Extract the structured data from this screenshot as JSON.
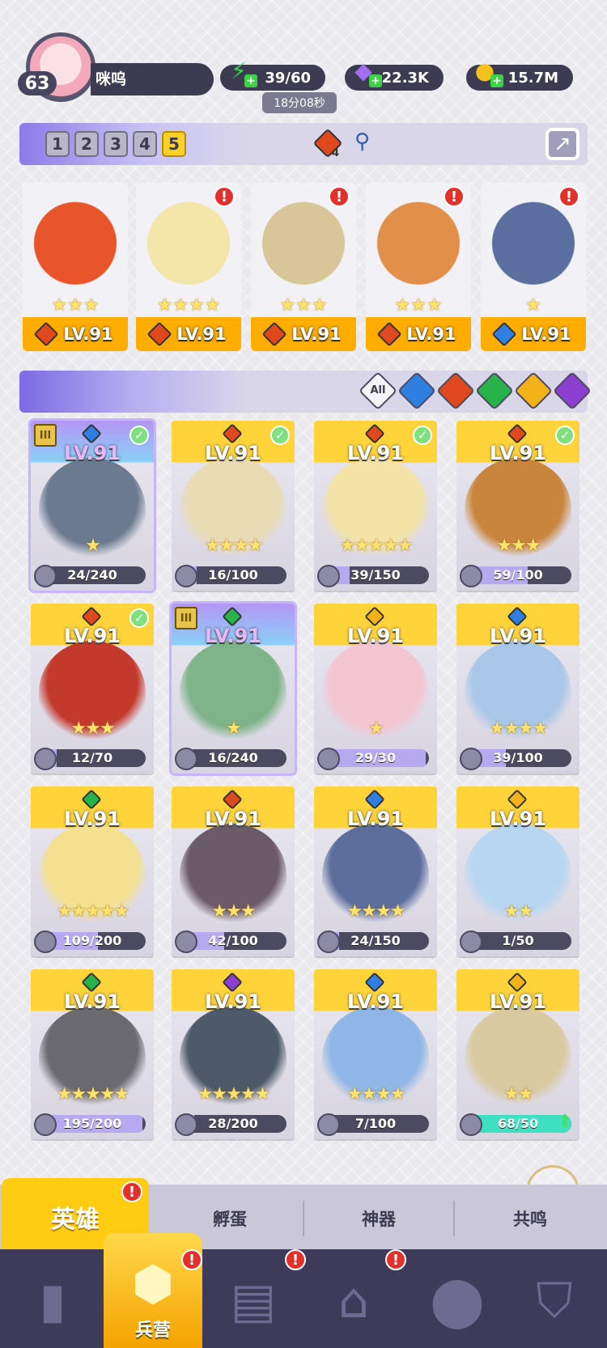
{
  "player": {
    "level": "63",
    "name": "咪呜"
  },
  "resources": {
    "energy": {
      "value": "39/60",
      "icon": "lightning-icon"
    },
    "gems": {
      "value": "22.3K",
      "icon": "diamond-icon"
    },
    "coins": {
      "value": "15.7M",
      "icon": "coin-icon"
    },
    "timer": "18分08秒"
  },
  "teams": {
    "slots": [
      "1",
      "2",
      "3",
      "4",
      "5"
    ],
    "active": "5",
    "fire_count": "4"
  },
  "team_heroes": [
    {
      "level": "LV.91",
      "stars": "★★★",
      "element": "fire",
      "art": "#e8552a"
    },
    {
      "level": "LV.91",
      "stars": "★★★★",
      "element": "fire",
      "art": "#f4e6a8"
    },
    {
      "level": "LV.91",
      "stars": "★★★",
      "element": "fire",
      "art": "#d8c598"
    },
    {
      "level": "LV.91",
      "stars": "★★★",
      "element": "fire",
      "art": "#e28f4a"
    },
    {
      "level": "LV.91",
      "stars": "★",
      "element": "water",
      "art": "#5a6fa0"
    }
  ],
  "filters": [
    "All",
    "water",
    "fire",
    "wind",
    "light",
    "dark"
  ],
  "heroes": [
    {
      "level": "LV.91",
      "stars": "★",
      "progress": "24/240",
      "frac": 0.1,
      "element": "water",
      "check": true,
      "art": "#6b7a8f",
      "purple": true
    },
    {
      "level": "LV.91",
      "stars": "★★★★",
      "progress": "16/100",
      "frac": 0.16,
      "element": "fire",
      "check": true,
      "art": "#e9dbb4"
    },
    {
      "level": "LV.91",
      "stars": "★★★★★",
      "progress": "39/150",
      "frac": 0.26,
      "element": "fire",
      "check": true,
      "art": "#f3e3a6"
    },
    {
      "level": "LV.91",
      "stars": "★★★",
      "progress": "59/100",
      "frac": 0.59,
      "element": "fire",
      "check": true,
      "art": "#c9853c"
    },
    {
      "level": "LV.91",
      "stars": "★★★",
      "progress": "12/70",
      "frac": 0.17,
      "element": "fire",
      "check": true,
      "art": "#c33a2c"
    },
    {
      "level": "LV.91",
      "stars": "★",
      "progress": "16/240",
      "frac": 0.07,
      "element": "wind",
      "check": false,
      "art": "#7fb38a",
      "purple": true
    },
    {
      "level": "LV.91",
      "stars": "★",
      "progress": "29/30",
      "frac": 0.97,
      "element": "light",
      "check": false,
      "art": "#f3c6d2"
    },
    {
      "level": "LV.91",
      "stars": "★★★★",
      "progress": "39/100",
      "frac": 0.39,
      "element": "water",
      "check": false,
      "art": "#a9c7e8"
    },
    {
      "level": "LV.91",
      "stars": "★★★★★",
      "progress": "109/200",
      "frac": 0.55,
      "element": "wind",
      "check": false,
      "art": "#f3e090"
    },
    {
      "level": "LV.91",
      "stars": "★★★",
      "progress": "42/100",
      "frac": 0.42,
      "element": "fire",
      "check": false,
      "art": "#6b5a6a"
    },
    {
      "level": "LV.91",
      "stars": "★★★★",
      "progress": "24/150",
      "frac": 0.16,
      "element": "water",
      "check": false,
      "art": "#5c6f9c"
    },
    {
      "level": "LV.91",
      "stars": "★★",
      "progress": "1/50",
      "frac": 0.02,
      "element": "light",
      "check": false,
      "art": "#b7d6f2"
    },
    {
      "level": "LV.91",
      "stars": "★★★★★",
      "progress": "195/200",
      "frac": 0.97,
      "element": "wind",
      "check": false,
      "art": "#6a6a70"
    },
    {
      "level": "LV.91",
      "stars": "★★★★★",
      "progress": "28/200",
      "frac": 0.14,
      "element": "dark",
      "check": false,
      "art": "#4e5a6a"
    },
    {
      "level": "LV.91",
      "stars": "★★★★",
      "progress": "7/100",
      "frac": 0.07,
      "element": "water",
      "check": false,
      "art": "#8fb6e6"
    },
    {
      "level": "LV.91",
      "stars": "★★",
      "progress": "68/50",
      "frac": 1.0,
      "element": "light",
      "check": false,
      "art": "#d9c9a0",
      "full": true,
      "up": true
    }
  ],
  "tabs": {
    "heroes": "英雄",
    "hatch": "孵蛋",
    "artifacts": "神器",
    "resonance": "共鸣"
  },
  "nav": {
    "barracks": "兵营"
  },
  "colors": {
    "fire": "#e0491e",
    "water": "#2f7fe0",
    "wind": "#28b34a",
    "light": "#f2b21a",
    "dark": "#8b3fd1",
    "accent": "#ffcc12"
  }
}
